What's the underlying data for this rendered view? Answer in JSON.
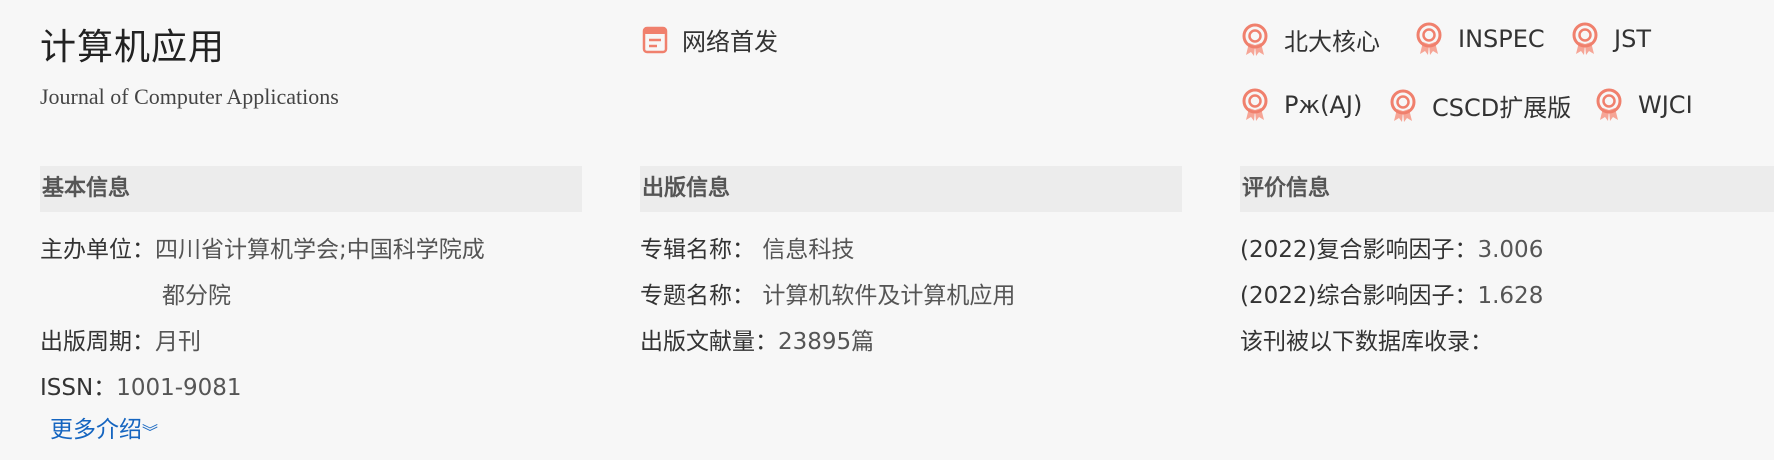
{
  "journal": {
    "title_cn": "计算机应用",
    "title_en": "Journal of Computer Applications",
    "online_first": "网络首发"
  },
  "badges": [
    "北大核心",
    "INSPEC",
    "JST",
    "Рж(AJ)",
    "CSCD扩展版",
    "WJCI"
  ],
  "basic_info": {
    "heading": "基本信息",
    "sponsor_label": "主办单位：",
    "sponsor_line1": "四川省计算机学会;中国科学院成",
    "sponsor_line2": "都分院",
    "period_label": "出版周期：",
    "period_value": "月刊",
    "issn_label": "ISSN：",
    "issn_value": "1001-9081",
    "more_link": "更多介绍"
  },
  "publish_info": {
    "heading": "出版信息",
    "album_label": "专辑名称：",
    "album_value": "信息科技",
    "topic_label": "专题名称：",
    "topic_value": "计算机软件及计算机应用",
    "count_label": "出版文献量：",
    "count_value": "23895篇"
  },
  "eval_info": {
    "heading": "评价信息",
    "composite_label": "(2022)复合影响因子：",
    "composite_value": "3.006",
    "comprehensive_label": "(2022)综合影响因子：",
    "comprehensive_value": "1.628",
    "indexed_label": "该刊被以下数据库收录："
  },
  "colors": {
    "badge": "#f0806d",
    "link": "#1565c0",
    "section_bg": "#ececec"
  },
  "icons": {
    "online_first": "document-icon",
    "badge": "award-ribbon-icon",
    "more": "double-chevron-down-icon"
  }
}
